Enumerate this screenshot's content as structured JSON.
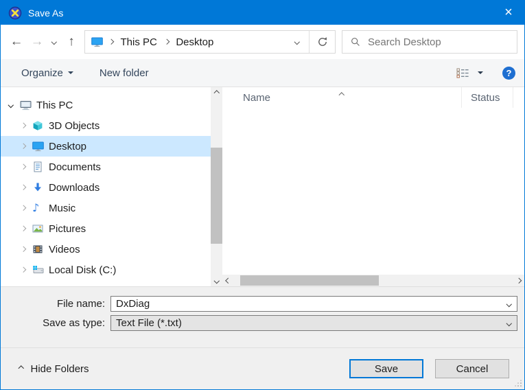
{
  "window": {
    "accent_color": "#0078d7",
    "selection_color": "#cce8ff"
  },
  "titlebar": {
    "title": "Save As",
    "close_glyph": "×"
  },
  "navbar": {
    "back_glyph": "←",
    "forward_glyph": "→",
    "up_glyph": "↑",
    "crumbs": [
      "This PC",
      "Desktop"
    ],
    "search_placeholder": "Search Desktop"
  },
  "toolbar": {
    "organize_label": "Organize",
    "new_folder_label": "New folder",
    "help_glyph": "?"
  },
  "sidebar": {
    "items": [
      {
        "label": "This PC"
      },
      {
        "label": "3D Objects"
      },
      {
        "label": "Desktop"
      },
      {
        "label": "Documents"
      },
      {
        "label": "Downloads"
      },
      {
        "label": "Music"
      },
      {
        "label": "Pictures"
      },
      {
        "label": "Videos"
      },
      {
        "label": "Local Disk (C:)"
      }
    ]
  },
  "filelist": {
    "columns": [
      "Name",
      "Status"
    ],
    "rows": []
  },
  "fields": {
    "file_name_label": "File name:",
    "file_name_value": "DxDiag",
    "save_as_type_label": "Save as type:",
    "save_as_type_value": "Text File (*.txt)"
  },
  "footer": {
    "hide_folders_label": "Hide Folders",
    "save_label": "Save",
    "cancel_label": "Cancel"
  },
  "icons": {
    "music_note_glyph": "♪"
  }
}
